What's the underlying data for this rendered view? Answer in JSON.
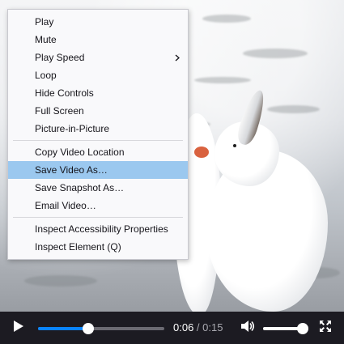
{
  "context_menu": {
    "items": [
      {
        "label": "Play",
        "has_submenu": false
      },
      {
        "label": "Mute",
        "has_submenu": false
      },
      {
        "label": "Play Speed",
        "has_submenu": true
      },
      {
        "label": "Loop",
        "has_submenu": false
      },
      {
        "label": "Hide Controls",
        "has_submenu": false
      },
      {
        "label": "Full Screen",
        "has_submenu": false
      },
      {
        "label": "Picture-in-Picture",
        "has_submenu": false
      },
      {
        "label": "Copy Video Location",
        "has_submenu": false
      },
      {
        "label": "Save Video As…",
        "has_submenu": false,
        "highlighted": true
      },
      {
        "label": "Save Snapshot As…",
        "has_submenu": false
      },
      {
        "label": "Email Video…",
        "has_submenu": false
      },
      {
        "label": "Inspect Accessibility Properties",
        "has_submenu": false
      },
      {
        "label": "Inspect Element (Q)",
        "has_submenu": false
      }
    ],
    "separators_after": [
      6,
      10
    ],
    "highlight_color": "#9bc8ef"
  },
  "video_controls": {
    "current_time": "0:06",
    "separator": " / ",
    "total_time": "0:15",
    "progress_fraction": 0.4,
    "volume_fraction": 0.92,
    "accent_color": "#0a84ff",
    "icons": {
      "play": "play-icon",
      "volume": "speaker-icon",
      "fullscreen": "fullscreen-icon",
      "submenu": "chevron-right-icon"
    }
  }
}
